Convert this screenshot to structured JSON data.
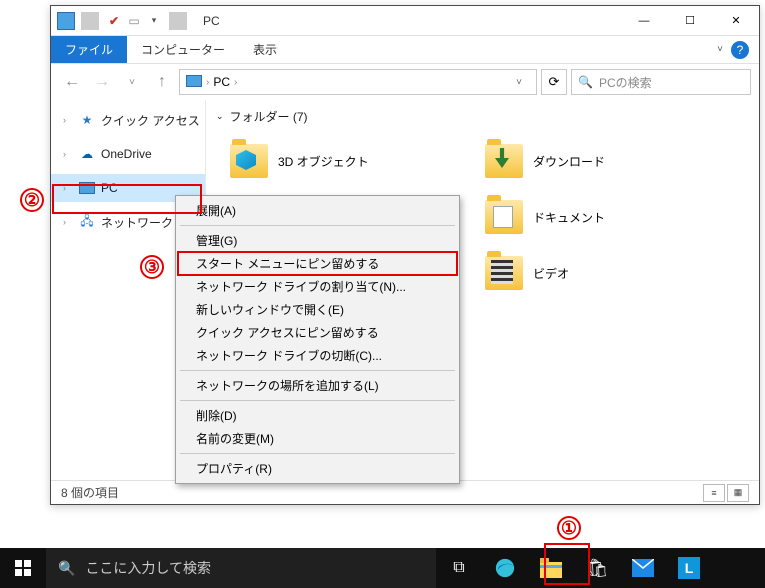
{
  "window": {
    "title": "PC",
    "ribbon": {
      "file": "ファイル",
      "tabs": [
        "コンピューター",
        "表示"
      ]
    },
    "nav": {
      "breadcrumb": [
        "PC"
      ],
      "search_placeholder": "PCの検索"
    },
    "sidebar": {
      "items": [
        {
          "label": "クイック アクセス",
          "icon": "star"
        },
        {
          "label": "OneDrive",
          "icon": "cloud"
        },
        {
          "label": "PC",
          "icon": "pc",
          "selected": true
        },
        {
          "label": "ネットワーク",
          "icon": "network"
        }
      ]
    },
    "content": {
      "folders_header": "フォルダー (7)",
      "folders": [
        {
          "label": "3D オブジェクト",
          "icon": "3d"
        },
        {
          "label": "ダウンロード",
          "icon": "dl"
        },
        {
          "label": "ドキュメント",
          "icon": "doc"
        },
        {
          "label": "ビデオ",
          "icon": "vid"
        }
      ]
    },
    "context_menu": {
      "groups": [
        [
          "展開(A)"
        ],
        [
          "管理(G)",
          "スタート メニューにピン留めする",
          "ネットワーク ドライブの割り当て(N)...",
          "新しいウィンドウで開く(E)",
          "クイック アクセスにピン留めする",
          "ネットワーク ドライブの切断(C)..."
        ],
        [
          "ネットワークの場所を追加する(L)"
        ],
        [
          "削除(D)",
          "名前の変更(M)"
        ],
        [
          "プロパティ(R)"
        ]
      ]
    },
    "status": {
      "item_count": "8 個の項目"
    }
  },
  "taskbar": {
    "search_placeholder": "ここに入力して検索"
  },
  "annotations": {
    "a1": "①",
    "a2": "②",
    "a3": "③"
  }
}
